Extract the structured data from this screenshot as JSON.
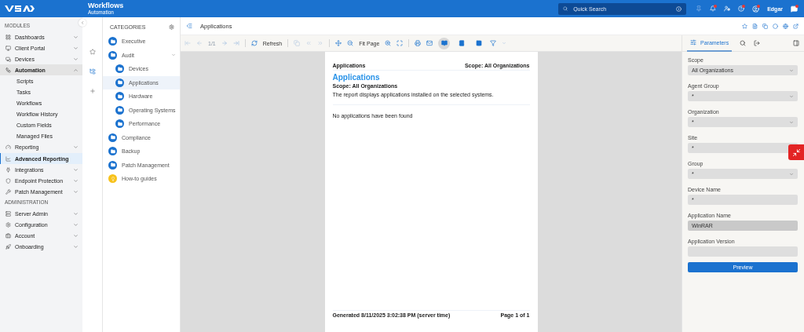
{
  "header": {
    "title": "Workflows",
    "subtitle": "Automation",
    "search_placeholder": "Quick Search",
    "user": "Edgar"
  },
  "sidebar": {
    "sections": [
      {
        "heading": "MODULES",
        "items": [
          {
            "label": "Dashboards",
            "expanded": false,
            "selected": false
          },
          {
            "label": "Client Portal",
            "expanded": false,
            "selected": false
          },
          {
            "label": "Devices",
            "expanded": false,
            "selected": false
          },
          {
            "label": "Automation",
            "expanded": true,
            "selected": false,
            "children": [
              {
                "label": "Scripts",
                "selected": false
              },
              {
                "label": "Tasks",
                "selected": false
              },
              {
                "label": "Workflows",
                "selected": false
              },
              {
                "label": "Workflow History",
                "selected": false
              },
              {
                "label": "Custom Fields",
                "selected": false
              },
              {
                "label": "Managed Files",
                "selected": false
              }
            ]
          },
          {
            "label": "Reporting",
            "expanded": false,
            "selected": false
          },
          {
            "label": "Advanced Reporting",
            "selected": true
          },
          {
            "label": "Integrations",
            "expanded": false,
            "selected": false
          },
          {
            "label": "Endpoint Protection",
            "expanded": false,
            "selected": false
          },
          {
            "label": "Patch Management",
            "expanded": false,
            "selected": false
          }
        ]
      },
      {
        "heading": "ADMINISTRATION",
        "items": [
          {
            "label": "Server Admin",
            "expanded": false,
            "selected": false
          },
          {
            "label": "Configuration",
            "expanded": false,
            "selected": false
          },
          {
            "label": "Account",
            "expanded": false,
            "selected": false
          },
          {
            "label": "Onboarding",
            "expanded": false,
            "selected": false
          }
        ]
      }
    ]
  },
  "categories": {
    "title": "CATEGORIES",
    "items": [
      {
        "label": "Executive",
        "kind": "folder",
        "selected": false
      },
      {
        "label": "Audit",
        "kind": "folder",
        "selected": false,
        "expanded": true,
        "children": [
          {
            "label": "Devices",
            "kind": "folder",
            "selected": false
          },
          {
            "label": "Applications",
            "kind": "folder",
            "selected": true
          },
          {
            "label": "Hardware",
            "kind": "folder",
            "selected": false
          },
          {
            "label": "Operating Systems",
            "kind": "folder",
            "selected": false
          },
          {
            "label": "Performance",
            "kind": "folder",
            "selected": false
          }
        ]
      },
      {
        "label": "Compliance",
        "kind": "folder",
        "selected": false
      },
      {
        "label": "Backup",
        "kind": "folder",
        "selected": false
      },
      {
        "label": "Patch Management",
        "kind": "folder",
        "selected": false
      },
      {
        "label": "How-to guides",
        "kind": "guide",
        "selected": false
      }
    ]
  },
  "viewer": {
    "title": "Applications",
    "toolbar": {
      "page_indicator": "1/1",
      "refresh": "Refresh",
      "zoom": "Fit Page",
      "views": [
        {
          "selected": true
        },
        {
          "selected": false
        },
        {
          "selected": false
        }
      ]
    }
  },
  "report": {
    "header_left": "Applications",
    "header_right": "Scope: All Organizations",
    "title": "Applications",
    "scope": "Scope: All Organizations",
    "description": "The report displays applications installed on the selected systems.",
    "empty_message": "No applications have been found",
    "footer_left": "Generated 8/11/2025 3:02:38 PM (server time)",
    "footer_right": "Page 1 of 1"
  },
  "parameters": {
    "tab": {
      "label": "Parameters",
      "selected": true
    },
    "fields": [
      {
        "label": "Scope",
        "value": "All Organizations",
        "kind": "select",
        "highlighted": false
      },
      {
        "label": "Agent Group",
        "value": "*",
        "kind": "select",
        "highlighted": false
      },
      {
        "label": "Organization",
        "value": "*",
        "kind": "select",
        "highlighted": false
      },
      {
        "label": "Site",
        "value": "*",
        "kind": "text",
        "highlighted": false
      },
      {
        "label": "Group",
        "value": "*",
        "kind": "select",
        "highlighted": false
      },
      {
        "label": "Device Name",
        "value": "*",
        "kind": "text",
        "highlighted": false
      },
      {
        "label": "Application Name",
        "value": "WinRAR",
        "kind": "text",
        "highlighted": true
      },
      {
        "label": "Application Version",
        "kind": "text",
        "highlighted": false
      }
    ],
    "button": "Preview"
  }
}
